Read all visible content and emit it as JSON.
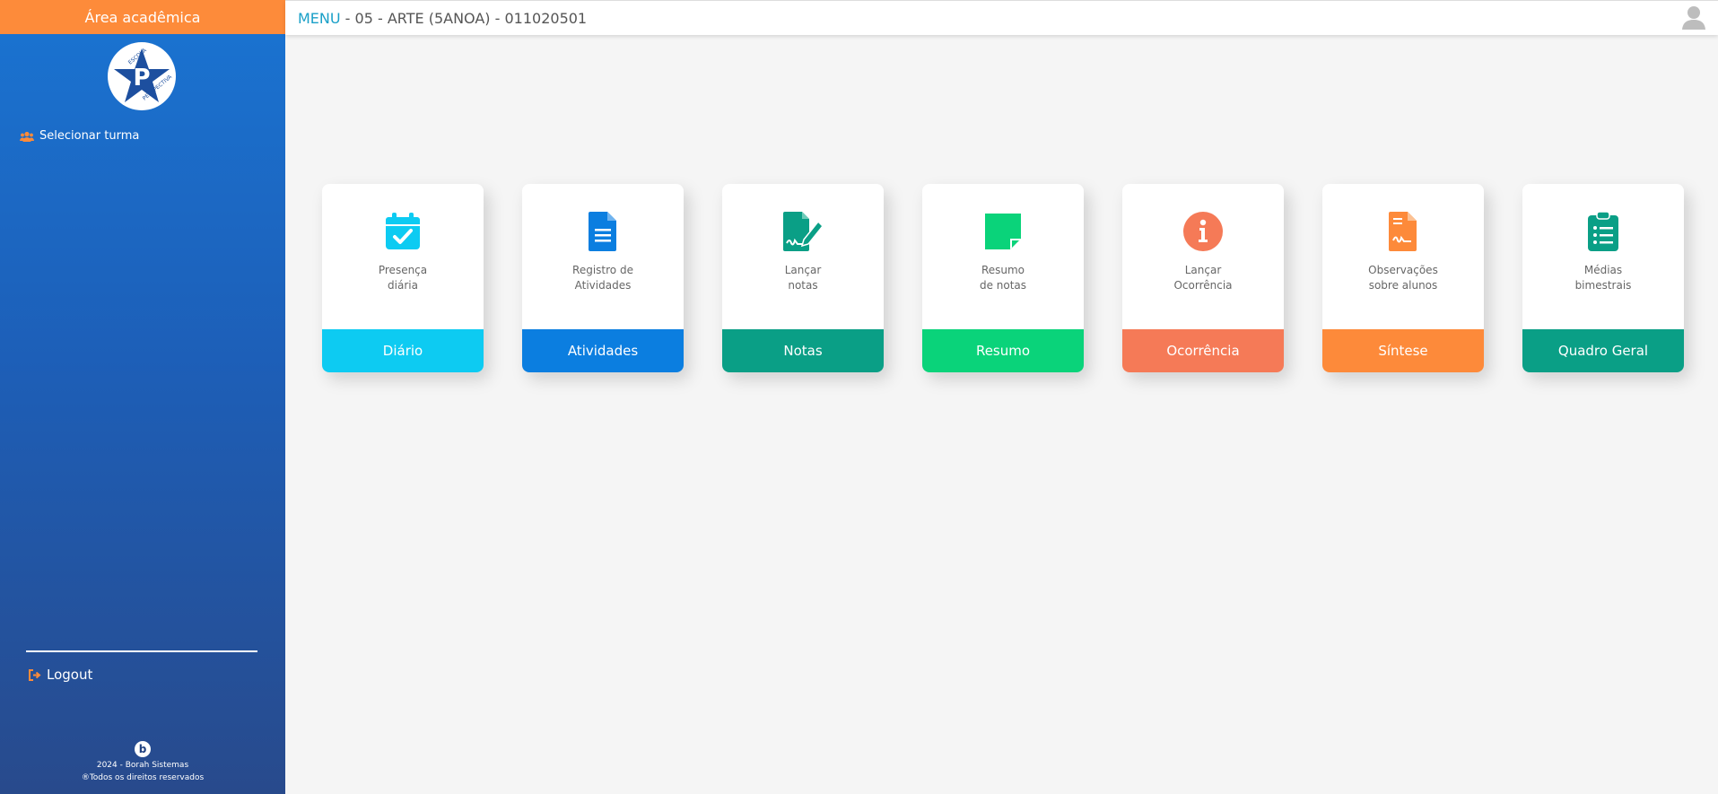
{
  "sidebar": {
    "area_title": "Área acadêmica",
    "logo_text_top": "ESCOLA",
    "logo_text_bottom": "PERSPECTIVA",
    "select_turma": "Selecionar turma",
    "logout": "Logout",
    "footer_logo": "b",
    "footer_line1": "2024 - Borah Sistemas",
    "footer_line2": "®Todos os direitos reservados"
  },
  "topbar": {
    "menu": "MENU",
    "title": " - 05 - ARTE (5ANOA) - 011020501"
  },
  "cards": [
    {
      "label": "Presença\ndiária",
      "button": "Diário",
      "color": "#0dcbf2",
      "icon": "calendar-check-icon"
    },
    {
      "label": "Registro de\nAtividades",
      "button": "Atividades",
      "color": "#0b7ee0",
      "icon": "file-lines-icon"
    },
    {
      "label": "Lançar\nnotas",
      "button": "Notas",
      "color": "#0a9f86",
      "icon": "file-signature-icon"
    },
    {
      "label": "Resumo\nde notas",
      "button": "Resumo",
      "color": "#0ad37a",
      "icon": "sticky-note-icon"
    },
    {
      "label": "Lançar\nOcorrência",
      "button": "Ocorrência",
      "color": "#f57a57",
      "icon": "info-circle-icon"
    },
    {
      "label": "Observações\nsobre alunos",
      "button": "Síntese",
      "color": "#fd8a3a",
      "icon": "file-contract-icon"
    },
    {
      "label": "Médias\nbimestrais",
      "button": "Quadro Geral",
      "color": "#0a9f86",
      "icon": "clipboard-list-icon"
    }
  ]
}
